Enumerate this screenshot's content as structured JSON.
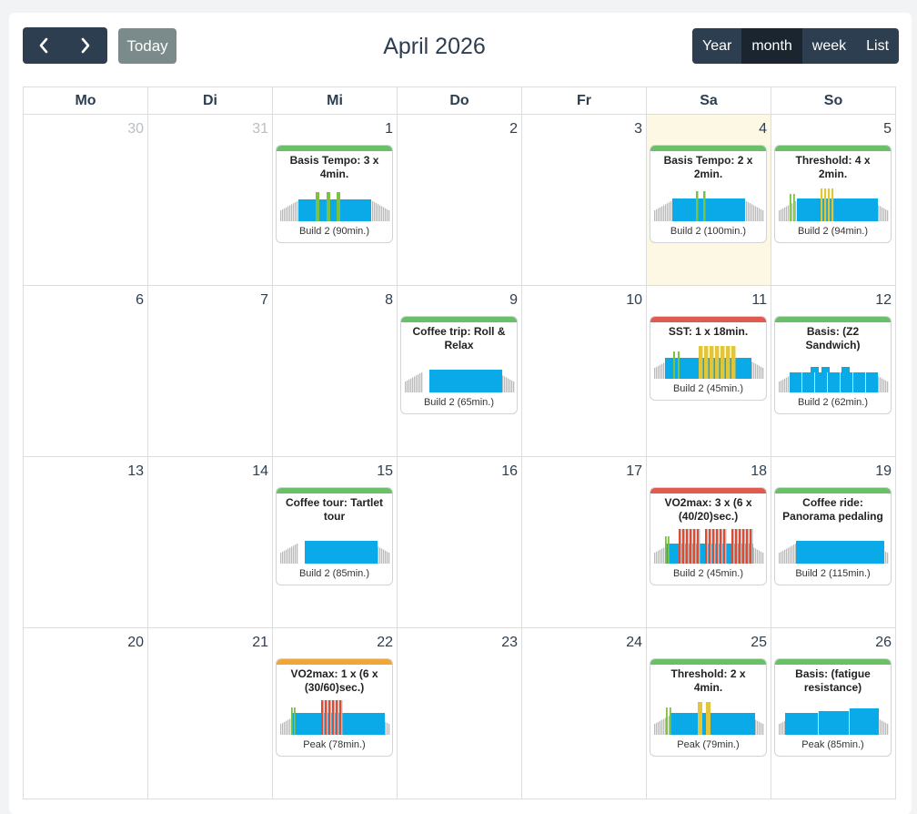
{
  "toolbar": {
    "prev_icon": "chevron-left-icon",
    "next_icon": "chevron-right-icon",
    "today_label": "Today",
    "title": "April 2026",
    "views": [
      {
        "label": "Year",
        "active": false
      },
      {
        "label": "month",
        "active": true
      },
      {
        "label": "week",
        "active": false
      },
      {
        "label": "List",
        "active": false
      }
    ]
  },
  "weekdays": [
    "Mo",
    "Di",
    "Mi",
    "Do",
    "Fr",
    "Sa",
    "So"
  ],
  "colors": {
    "green": "#6abf69",
    "red": "#e05a4f",
    "orange": "#f0a73a",
    "blue": "#0aa9e8",
    "gray": "#bbbbbb",
    "today_bg": "#fcf8e3"
  },
  "weeks": [
    [
      {
        "num": "30",
        "other": true
      },
      {
        "num": "31",
        "other": true
      },
      {
        "num": "1",
        "event": {
          "title": "Basis Tempo: 3 x 4min.",
          "sub": "Build 2 (90min.)",
          "color": "green",
          "type": "tempo3"
        }
      },
      {
        "num": "2"
      },
      {
        "num": "3"
      },
      {
        "num": "4",
        "today": true,
        "event": {
          "title": "Basis Tempo: 2 x 2min.",
          "sub": "Build 2 (100min.)",
          "color": "green",
          "type": "tempo2"
        }
      },
      {
        "num": "5",
        "event": {
          "title": "Threshold: 4 x 2min.",
          "sub": "Build 2 (94min.)",
          "color": "green",
          "type": "threshold4"
        }
      }
    ],
    [
      {
        "num": "6"
      },
      {
        "num": "7"
      },
      {
        "num": "8"
      },
      {
        "num": "9",
        "event": {
          "title": "Coffee trip: Roll & Relax",
          "sub": "Build 2 (65min.)",
          "color": "green",
          "type": "flat"
        }
      },
      {
        "num": "10"
      },
      {
        "num": "11",
        "event": {
          "title": "SST: 1 x 18min.",
          "sub": "Build 2 (45min.)",
          "color": "red",
          "type": "sst"
        }
      },
      {
        "num": "12",
        "event": {
          "title": "Basis: (Z2 Sandwich)",
          "sub": "Build 2 (62min.)",
          "color": "green",
          "type": "sandwich"
        }
      }
    ],
    [
      {
        "num": "13"
      },
      {
        "num": "14"
      },
      {
        "num": "15",
        "event": {
          "title": "Coffee tour: Tartlet tour",
          "sub": "Build 2 (85min.)",
          "color": "green",
          "type": "flat"
        }
      },
      {
        "num": "16"
      },
      {
        "num": "17"
      },
      {
        "num": "18",
        "event": {
          "title": "VO2max: 3 x (6 x (40/20)sec.)",
          "sub": "Build 2 (45min.)",
          "color": "red",
          "type": "vo2x3"
        }
      },
      {
        "num": "19",
        "event": {
          "title": "Coffee ride: Panorama pedaling",
          "sub": "Build 2 (115min.)",
          "color": "green",
          "type": "flat2"
        }
      }
    ],
    [
      {
        "num": "20"
      },
      {
        "num": "21"
      },
      {
        "num": "22",
        "event": {
          "title": "VO2max: 1 x (6 x (30/60)sec.)",
          "sub": "Peak (78min.)",
          "color": "orange",
          "type": "vo2x1"
        }
      },
      {
        "num": "23"
      },
      {
        "num": "24"
      },
      {
        "num": "25",
        "event": {
          "title": "Threshold: 2 x 4min.",
          "sub": "Peak (79min.)",
          "color": "green",
          "type": "threshold2"
        }
      },
      {
        "num": "26",
        "event": {
          "title": "Basis: (fatigue resistance)",
          "sub": "Peak (85min.)",
          "color": "green",
          "type": "fatigue"
        }
      }
    ]
  ]
}
